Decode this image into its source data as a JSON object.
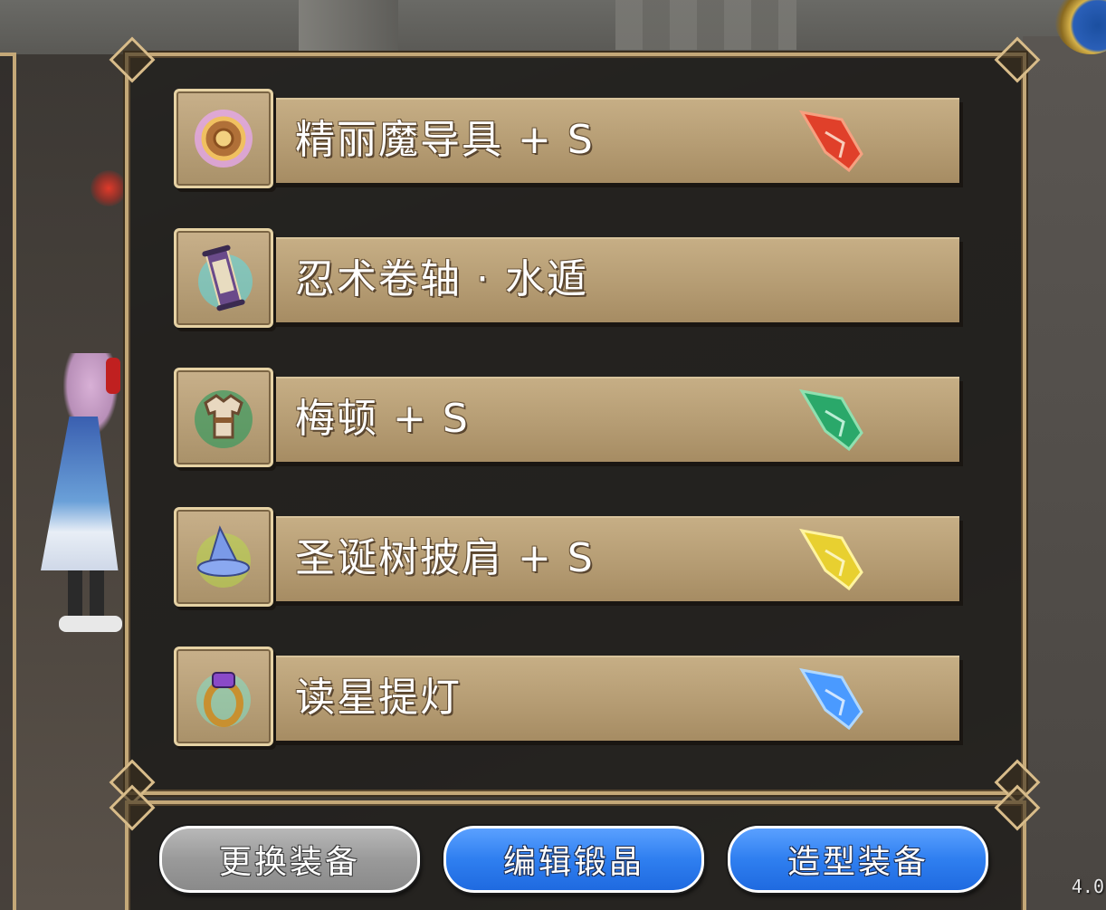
{
  "items": [
    {
      "name": "精丽魔导具 + S",
      "icon": "orb-accessory-icon",
      "gem_color": "#e0402a",
      "gem": "red-crystal-icon"
    },
    {
      "name": "忍术卷轴 · 水遁",
      "icon": "scroll-icon",
      "gem_color": "",
      "gem": ""
    },
    {
      "name": "梅顿 + S",
      "icon": "armor-shirt-icon",
      "gem_color": "#2aa86a",
      "gem": "green-crystal-icon"
    },
    {
      "name": "圣诞树披肩 + S",
      "icon": "witch-hat-icon",
      "gem_color": "#e8d030",
      "gem": "yellow-crystal-icon"
    },
    {
      "name": "读星提灯",
      "icon": "ring-icon",
      "gem_color": "#4a9aff",
      "gem": "blue-crystal-icon"
    }
  ],
  "buttons": {
    "change_equipment": "更换装备",
    "edit_crystals": "编辑锻晶",
    "style_equipment": "造型装备"
  },
  "version": "4.0"
}
